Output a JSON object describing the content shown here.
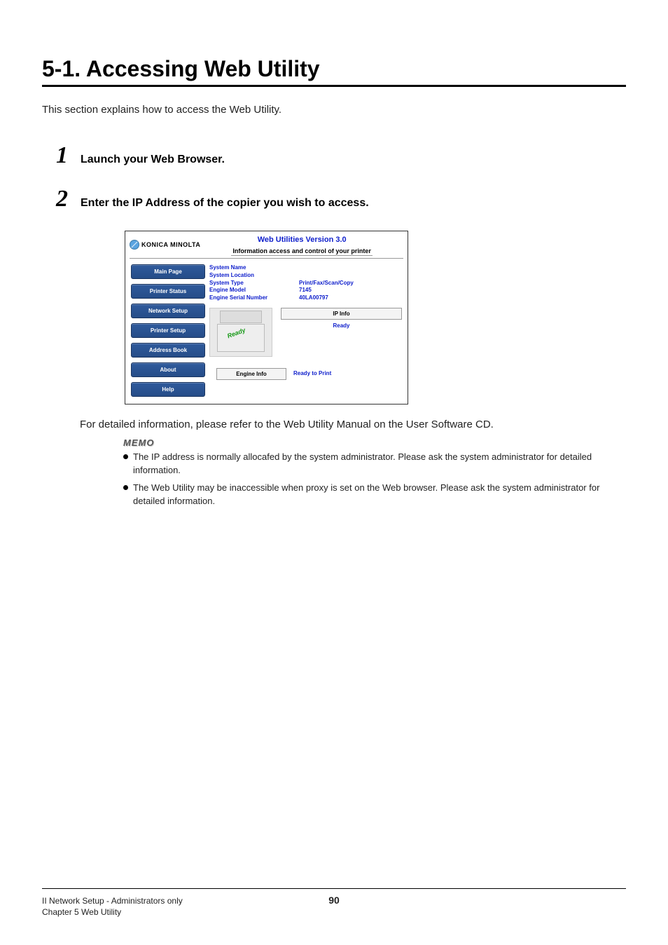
{
  "heading": "5-1. Accessing Web Utility",
  "intro": "This section explains how to access the Web Utility.",
  "steps": [
    {
      "num": "1",
      "text": "Launch your Web Browser."
    },
    {
      "num": "2",
      "text": "Enter the IP Address of the copier you wish to access."
    }
  ],
  "screenshot": {
    "logo_text": "KONICA MINOLTA",
    "title": "Web Utilities Version 3.0",
    "subtitle": "Information access and control of your printer",
    "side_buttons": [
      "Main Page",
      "Printer Status",
      "Network Setup",
      "Printer Setup",
      "Address Book",
      "About",
      "Help"
    ],
    "info_rows": [
      {
        "label": "System Name",
        "value": ""
      },
      {
        "label": "System Location",
        "value": ""
      },
      {
        "label": "System Type",
        "value": "Print/Fax/Scan/Copy"
      },
      {
        "label": "Engine Model",
        "value": "7145"
      },
      {
        "label": "Engine Serial Number",
        "value": "40LA00797"
      }
    ],
    "printer_tag": "Ready",
    "ip_info_btn": "IP Info",
    "ready_text": "Ready",
    "engine_label": "Engine Info",
    "engine_value": "Ready to Print"
  },
  "detail_line": "For detailed information, please refer to the Web Utility Manual on the User Software CD.",
  "memo_label": "MEMO",
  "memo_items": [
    "The IP address is normally allocafed by the system administrator. Please ask the system administrator for detailed information.",
    "The Web Utility may be inaccessible when proxy is set on the Web browser. Please ask the system administrator for detailed information."
  ],
  "footer": {
    "left": "II Network Setup - Administrators only",
    "page": "90",
    "sub": "Chapter 5 Web Utility"
  }
}
